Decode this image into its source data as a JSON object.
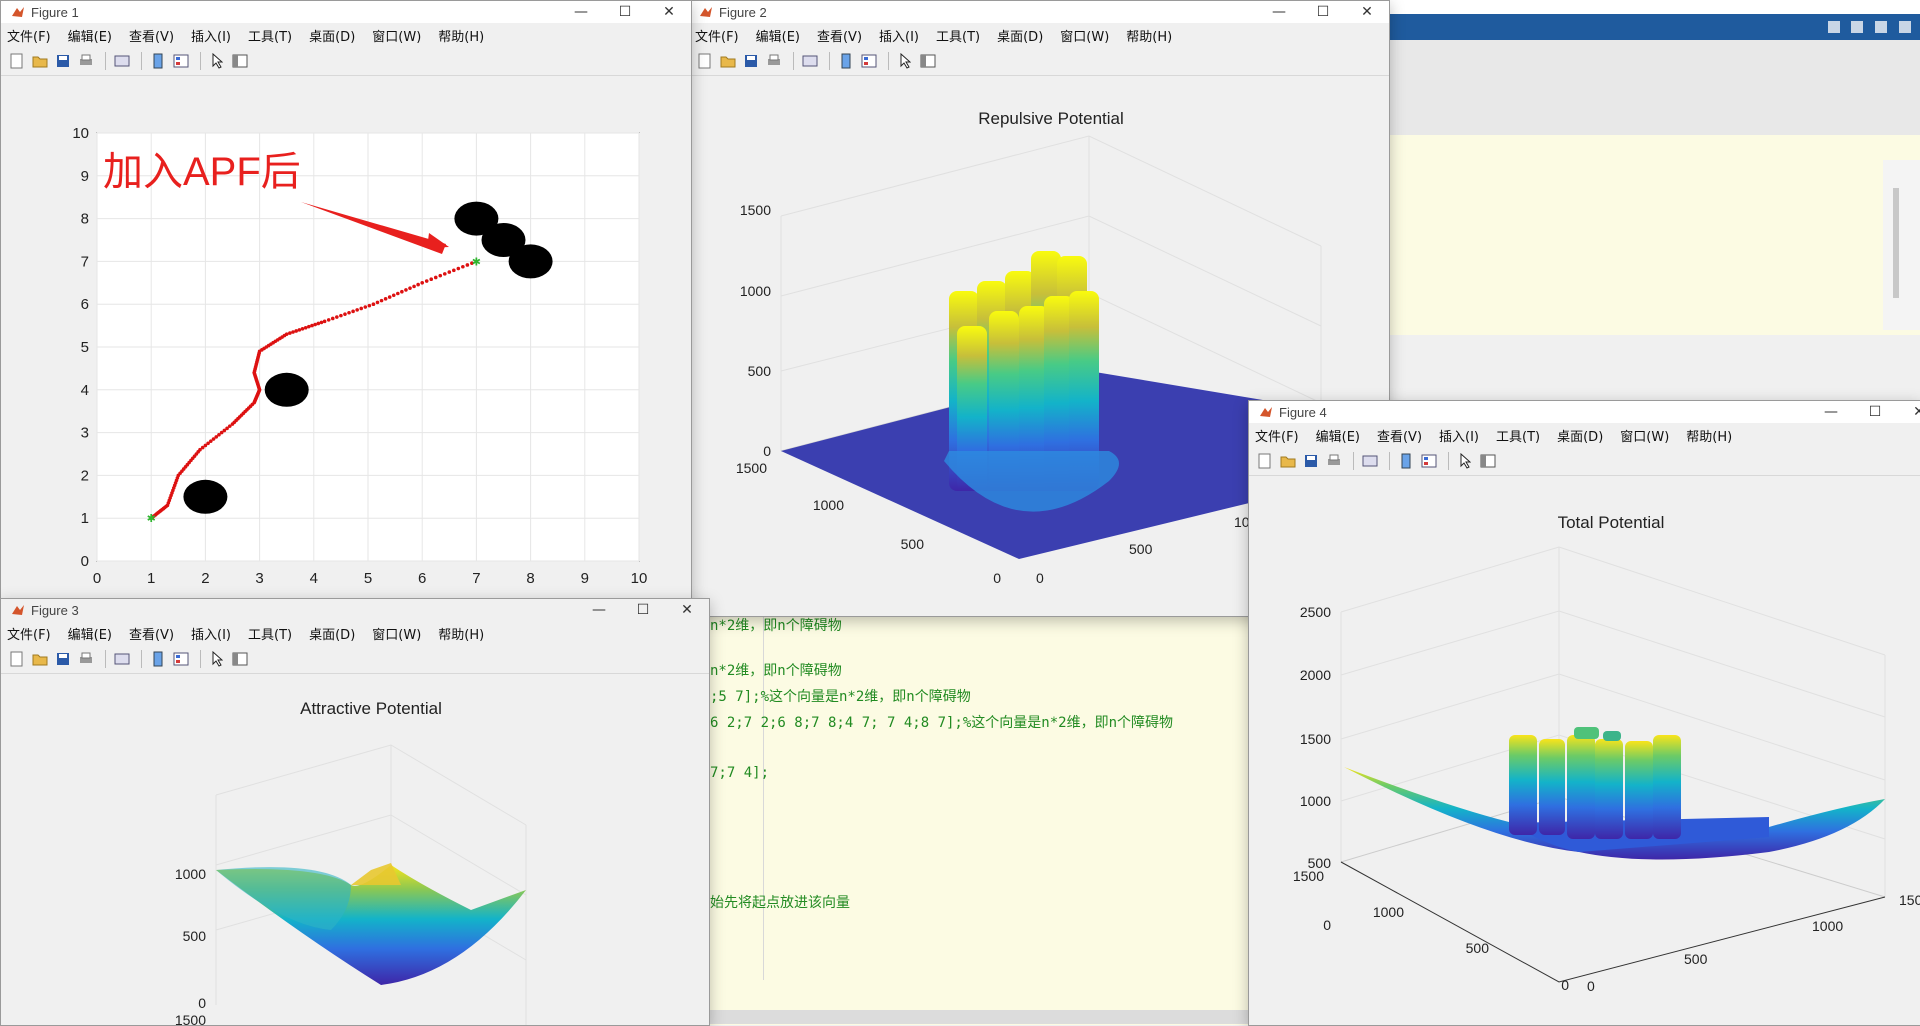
{
  "figures": {
    "fig1": {
      "title": "Figure 1"
    },
    "fig2": {
      "title": "Figure 2"
    },
    "fig3": {
      "title": "Figure 3"
    },
    "fig4": {
      "title": "Figure 4"
    }
  },
  "menu": [
    "文件(F)",
    "编辑(E)",
    "查看(V)",
    "插入(I)",
    "工具(T)",
    "桌面(D)",
    "窗口(W)",
    "帮助(H)"
  ],
  "editor_lines": [
    "n*2维，即n个障碍物",
    "n*2维，即n个障碍物",
    ";5 7];%这个向量是n*2维，即n个障碍物",
    "6 2;7 2;6 8;7 8;4 7; 7 4;8 7];%这个向量是n*2维，即n个障碍物",
    "7;7 4];",
    "始先将起点放进该向量"
  ],
  "colors": {
    "editor_bg": "#fcfbe3",
    "comment": "#228b22",
    "matlab_blue": "#1f5b9e"
  },
  "plots": {
    "path_annotation": "加入APF后",
    "repulsive_title": "Repulsive Potential",
    "attractive_title": "Attractive Potential",
    "total_title": "Total Potential"
  },
  "chart_data": [
    {
      "type": "scatter",
      "title": "",
      "annotation": "加入APF后",
      "xlim": [
        0,
        10
      ],
      "ylim": [
        0,
        10
      ],
      "xticks": [
        0,
        1,
        2,
        3,
        4,
        5,
        6,
        7,
        8,
        9,
        10
      ],
      "yticks": [
        0,
        1,
        2,
        3,
        4,
        5,
        6,
        7,
        8,
        9,
        10
      ],
      "grid": true,
      "start": [
        1,
        1
      ],
      "goal": [
        7,
        7
      ],
      "obstacles": [
        [
          2,
          1.5
        ],
        [
          3.5,
          4
        ],
        [
          7,
          8
        ],
        [
          7.5,
          7.5
        ],
        [
          8,
          7
        ]
      ],
      "path": [
        [
          1,
          1
        ],
        [
          1.3,
          1.3
        ],
        [
          1.5,
          2
        ],
        [
          1.9,
          2.6
        ],
        [
          2.5,
          3.2
        ],
        [
          2.9,
          3.7
        ],
        [
          3.0,
          4.0
        ],
        [
          2.9,
          4.4
        ],
        [
          3.0,
          4.9
        ],
        [
          3.5,
          5.3
        ],
        [
          4.2,
          5.6
        ],
        [
          5.1,
          6.0
        ],
        [
          6.0,
          6.5
        ],
        [
          7,
          7
        ]
      ]
    },
    {
      "type": "surface",
      "title": "Repulsive Potential",
      "zticks": [
        0,
        500,
        1000,
        1500
      ],
      "xticks": [
        0,
        500,
        1000
      ],
      "yticks": [
        0,
        500,
        1000,
        1500
      ]
    },
    {
      "type": "surface",
      "title": "Attractive Potential",
      "zticks": [
        0,
        500,
        1000
      ],
      "yticks": [
        1500
      ]
    },
    {
      "type": "surface",
      "title": "Total Potential",
      "zticks": [
        0,
        500,
        1000,
        1500,
        2000,
        2500
      ],
      "xticks": [
        0,
        500,
        1000
      ],
      "yticks": [
        0,
        500,
        1000,
        1500
      ]
    }
  ]
}
